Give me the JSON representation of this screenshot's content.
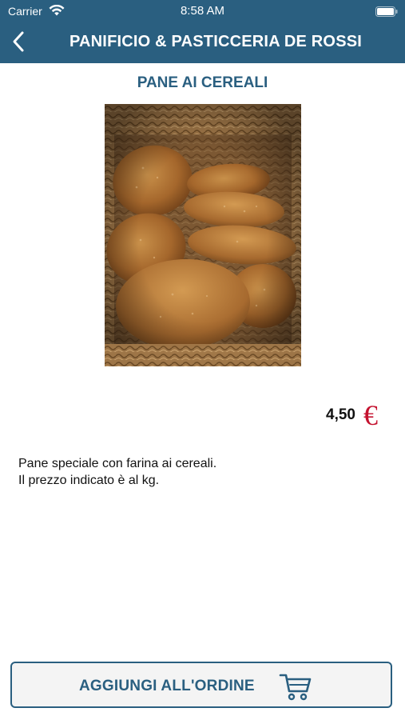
{
  "status_bar": {
    "carrier": "Carrier",
    "time": "8:58 AM"
  },
  "header": {
    "title": "PANIFICIO & PASTICCERIA DE ROSSI",
    "back_icon": "chevron-left-icon"
  },
  "product": {
    "name": "PANE AI CEREALI",
    "photo_icon": "bread-basket-photo",
    "price": "4,50",
    "currency_icon": "euro-icon",
    "description": [
      "Pane speciale con farina ai cereali.",
      "Il prezzo indicato è al kg."
    ]
  },
  "footer": {
    "add_button_label": "AGGIUNGI ALL'ORDINE",
    "cart_icon": "cart-icon"
  },
  "colors": {
    "primary": "#2a5f80",
    "price_accent": "#c4122f",
    "button_background": "#f4f4f4"
  }
}
